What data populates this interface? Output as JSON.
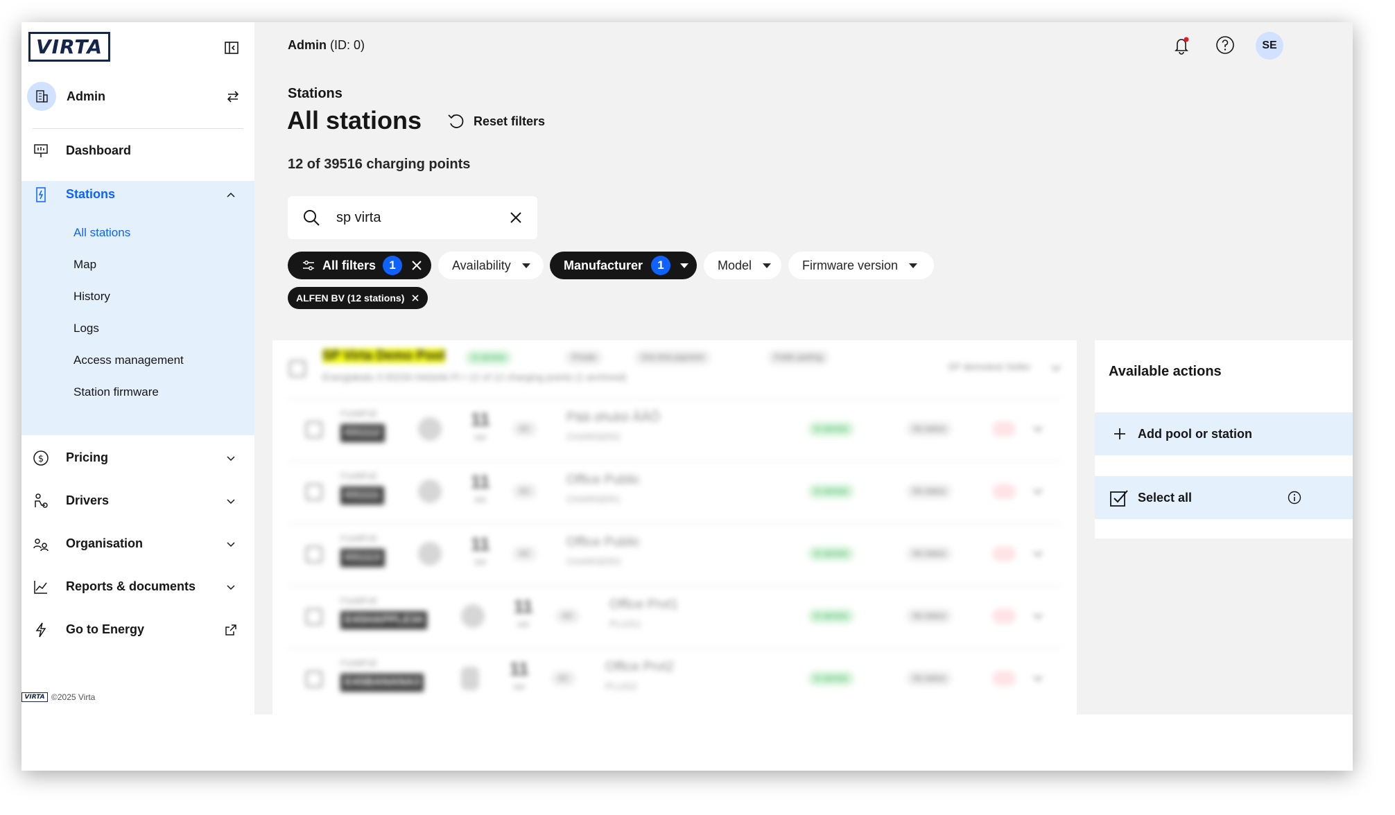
{
  "brand": {
    "logo_text": "VIRTA"
  },
  "account": {
    "name": "Admin"
  },
  "nav": [
    {
      "label": "Dashboard"
    },
    {
      "label": "Stations"
    },
    {
      "label": "Pricing"
    },
    {
      "label": "Drivers"
    },
    {
      "label": "Organisation"
    },
    {
      "label": "Reports & documents"
    },
    {
      "label": "Go to Energy"
    }
  ],
  "stations_sub": [
    "All stations",
    "Map",
    "History",
    "Logs",
    "Access management",
    "Station firmware"
  ],
  "footer": {
    "copyright": "©2025 Virta"
  },
  "header": {
    "user_name": "Admin",
    "user_id": "(ID: 0)",
    "avatar_initials": "SE"
  },
  "page": {
    "breadcrumb": "Stations",
    "title": "All stations",
    "reset_label": "Reset filters",
    "count_text": "12 of 39516 charging points"
  },
  "search": {
    "value": "sp virta"
  },
  "filters": {
    "all_filters": "All filters",
    "all_filters_count": "1",
    "availability": "Availability",
    "manufacturer": "Manufacturer",
    "manufacturer_count": "1",
    "model": "Model",
    "firmware": "Firmware version",
    "active_tag": "ALFEN BV (12 stations)"
  },
  "pool": {
    "name": "SP Virta Demo Pool",
    "status": "In service",
    "tags": [
      "Private",
      "One time payment",
      "Public parking"
    ],
    "address": "Energiakatu 3 00234 Helsinki FI • 12 of 12 charging points (1 archived)",
    "seller": "SP demotest Seller"
  },
  "stations": [
    {
      "id_label": "F1eWFzE",
      "id": "031112",
      "power": "11",
      "unit": "kW",
      "type": "AC",
      "name": "Pää ohuloi ÄÄÖ",
      "sub": "CHARGER2",
      "status": "In service",
      "sub_status": "No status"
    },
    {
      "id_label": "F1eWFzE",
      "id": "031111",
      "power": "11",
      "unit": "kW",
      "type": "AC",
      "name": "Office Public",
      "sub": "CHARGER1",
      "status": "In service",
      "sub_status": "No status"
    },
    {
      "id_label": "F1eWFzE",
      "id": "031113",
      "power": "11",
      "unit": "kW",
      "type": "AC",
      "name": "Office Public",
      "sub": "CHARGER3",
      "status": "In service",
      "sub_status": "No status"
    },
    {
      "id_label": "F1eWFzE",
      "id": "E4SHAPPLE34",
      "power": "11",
      "unit": "kW",
      "type": "AC",
      "name": "Office Prvt1",
      "sub": "PLUG1",
      "status": "In service",
      "sub_status": "No status"
    },
    {
      "id_label": "F1eWFzE",
      "id": "E4SBANANA3",
      "power": "11",
      "unit": "kW",
      "type": "AC",
      "name": "Office Prvt2",
      "sub": "PLUG2",
      "status": "In service",
      "sub_status": "No status"
    }
  ],
  "actions": {
    "title": "Available actions",
    "add_label": "Add pool or station",
    "select_all_label": "Select all"
  },
  "colors": {
    "accent": "#0f62fe",
    "active_bg": "#e5f0fd",
    "dark_chip": "#161616",
    "status_green": "#24a148",
    "highlight": "#f1f80a"
  }
}
